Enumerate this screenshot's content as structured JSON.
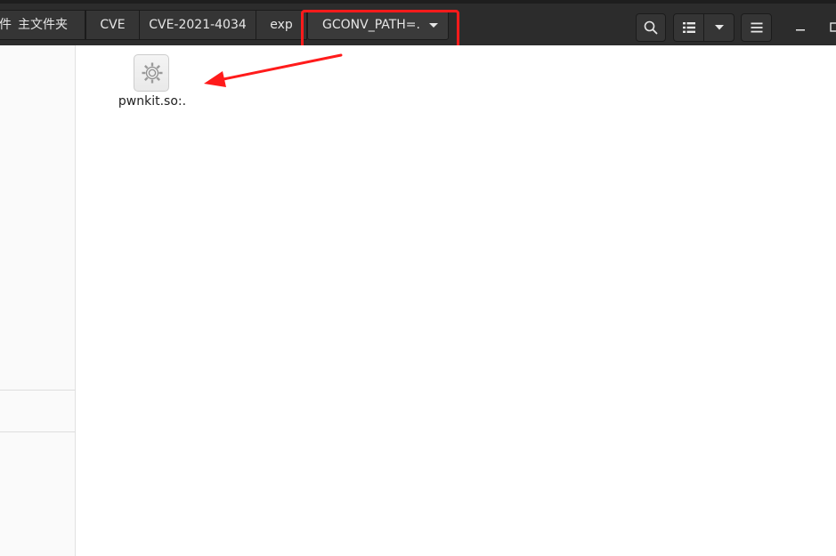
{
  "breadcrumb": {
    "partial_fragment": "件",
    "home_label": "主文件夹",
    "items": [
      "CVE",
      "CVE-2021-4034",
      "exp"
    ],
    "current": "GCONV_PATH=."
  },
  "files": [
    {
      "name": "pwnkit.so:.",
      "icon": "gear-icon"
    }
  ],
  "colors": {
    "header_bg": "#2c2c2c",
    "annotation_red": "#ff1b1b"
  }
}
